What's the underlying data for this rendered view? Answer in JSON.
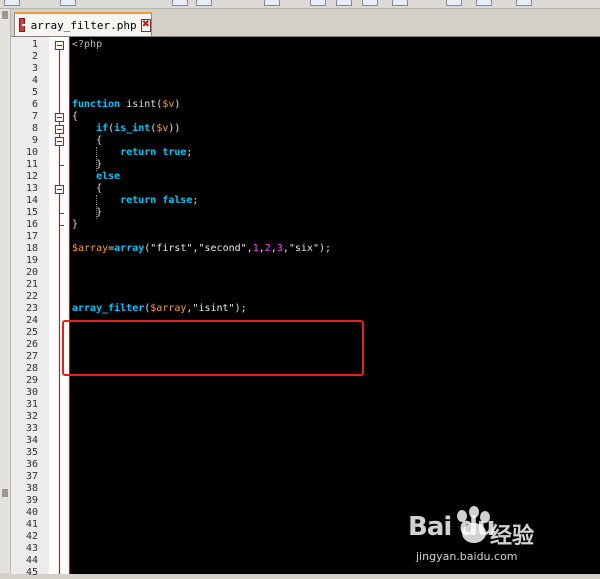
{
  "tab": {
    "filename": "array_filter.php",
    "close_glyph": "✖"
  },
  "line_numbers": [
    "1",
    "2",
    "3",
    "4",
    "5",
    "6",
    "7",
    "8",
    "9",
    "10",
    "11",
    "12",
    "13",
    "14",
    "15",
    "16",
    "17",
    "18",
    "19",
    "20",
    "21",
    "22",
    "23",
    "24",
    "25",
    "26",
    "27",
    "28",
    "29",
    "30",
    "31",
    "32",
    "33",
    "34",
    "35",
    "36",
    "37",
    "38",
    "39",
    "40",
    "41",
    "42",
    "43",
    "44",
    "45"
  ],
  "code": {
    "l1": "<?php",
    "l6_kw": "function",
    "l6_name": " isint(",
    "l6_var": "$v",
    "l6_end": ")",
    "l7": "{",
    "l8_kw": "if",
    "l8_a": "(",
    "l8_fn": "is_int",
    "l8_b": "(",
    "l8_var": "$v",
    "l8_c": "))",
    "l9": "{",
    "l10_kw": "return",
    "l10_val": " true",
    "l10_end": ";",
    "l11": "}",
    "l12_kw": "else",
    "l13": "{",
    "l14_kw": "return",
    "l14_val": " false",
    "l14_end": ";",
    "l15": "}",
    "l16": "}",
    "l18_var": "$array",
    "l18_eq": "=",
    "l18_fn": "array",
    "l18_open": "(",
    "l18_s1": "\"first\"",
    "l18_c1": ",",
    "l18_s2": "\"second\"",
    "l18_c2": ",",
    "l18_n1": "1",
    "l18_c3": ",",
    "l18_n2": "2",
    "l18_c4": ",",
    "l18_n3": "3",
    "l18_c5": ",",
    "l18_s3": "\"six\"",
    "l18_close": ");",
    "l23_fn": "array_filter",
    "l23_open": "(",
    "l23_var": "$array",
    "l23_c": ",",
    "l23_s": "\"isint\"",
    "l23_close": ");"
  },
  "watermark": {
    "logo": "Bai du",
    "brand": "经验",
    "url": "jingyan.baidu.com"
  },
  "colors": {
    "keyword": "#00c8ff",
    "variable": "#ff9c34",
    "number": "#ff44ff",
    "highlight": "#e8201c",
    "tab_accent": "#f0a030"
  }
}
